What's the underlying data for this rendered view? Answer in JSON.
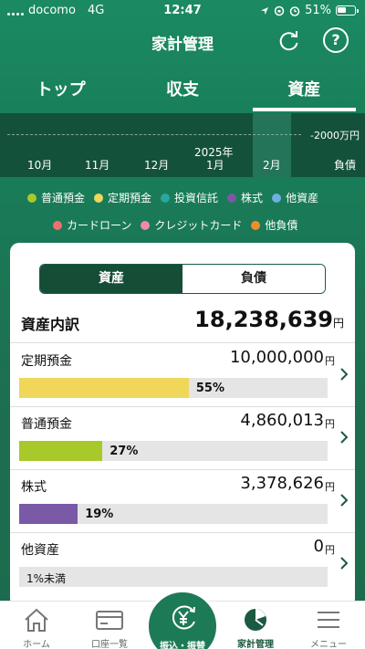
{
  "status_bar": {
    "carrier": "docomo",
    "network": "4G",
    "time": "12:47",
    "battery": "51%"
  },
  "header": {
    "title": "家計管理"
  },
  "tabs": [
    {
      "label": "トップ"
    },
    {
      "label": "収支"
    },
    {
      "label": "資産",
      "active": true
    }
  ],
  "timeline": {
    "axis_label": "-2000万円",
    "months": [
      "10月",
      "11月",
      "12月",
      "1月",
      "2月"
    ],
    "year_label": "2025年",
    "liability_label": "負債",
    "selected_month": "2月"
  },
  "legend": [
    {
      "label": "普通預金",
      "color": "#a8c92a"
    },
    {
      "label": "定期預金",
      "color": "#f0d75a"
    },
    {
      "label": "投資信託",
      "color": "#2aa6a0"
    },
    {
      "label": "株式",
      "color": "#7a5aa6"
    },
    {
      "label": "他資産",
      "color": "#6fb0e0"
    },
    {
      "label": "カードローン",
      "color": "#f07070"
    },
    {
      "label": "クレジットカード",
      "color": "#f08aa8"
    },
    {
      "label": "他負債",
      "color": "#f08c2a"
    }
  ],
  "segment": {
    "assets": "資産",
    "liabilities": "負債"
  },
  "summary": {
    "label": "資産内訳",
    "value": "18,238,639",
    "unit": "円"
  },
  "rows": [
    {
      "name": "定期預金",
      "amount": "10,000,000",
      "unit": "円",
      "percent_label": "55%",
      "fraction": 0.55,
      "color": "#f0d75a"
    },
    {
      "name": "普通預金",
      "amount": "4,860,013",
      "unit": "円",
      "percent_label": "27%",
      "fraction": 0.27,
      "color": "#a8c92a"
    },
    {
      "name": "株式",
      "amount": "3,378,626",
      "unit": "円",
      "percent_label": "19%",
      "fraction": 0.19,
      "color": "#7a5aa6"
    },
    {
      "name": "他資産",
      "amount": "0",
      "unit": "円",
      "percent_label": "1%未満",
      "fraction": 0,
      "color": "#6fb0e0"
    }
  ],
  "bottom_nav": [
    {
      "label": "ホーム"
    },
    {
      "label": "口座一覧"
    },
    {
      "label": "振込・振替"
    },
    {
      "label": "家計管理",
      "active": true
    },
    {
      "label": "メニュー"
    }
  ]
}
